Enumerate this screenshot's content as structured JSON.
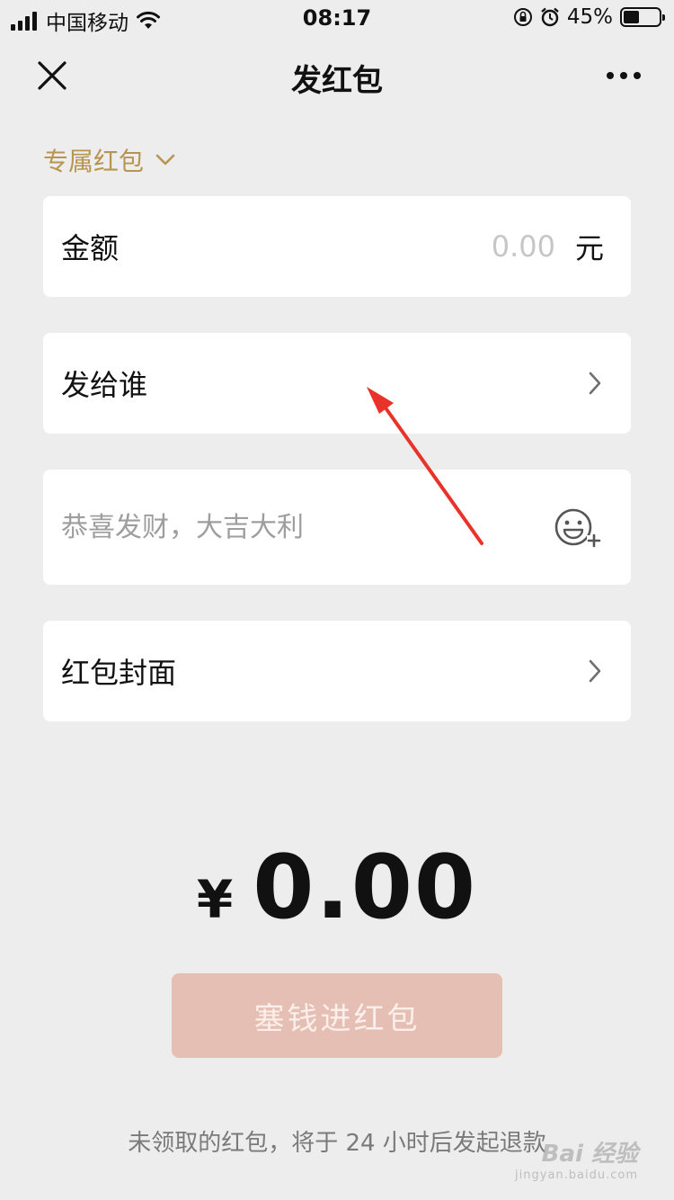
{
  "status_bar": {
    "carrier": "中国移动",
    "time": "08:17",
    "battery_percent": "45%",
    "battery_level": 0.45
  },
  "nav": {
    "title": "发红包",
    "close_icon": "close-icon",
    "more_icon": "more-dots-icon"
  },
  "packet_type": {
    "label": "专属红包",
    "icon": "chevron-down-icon",
    "color": "#b8954f"
  },
  "amount": {
    "label": "金额",
    "placeholder": "0.00",
    "unit": "元"
  },
  "recipient": {
    "label": "发给谁"
  },
  "greeting": {
    "placeholder": "恭喜发财，大吉大利",
    "emoji_icon": "emoji-add-icon"
  },
  "cover": {
    "label": "红包封面"
  },
  "total": {
    "currency": "¥",
    "value": "0.00"
  },
  "submit": {
    "label": "塞钱进红包",
    "color": "#e6bfb4"
  },
  "notice": "未领取的红包，将于 24 小时后发起退款",
  "annotation": {
    "color": "#e8322a"
  },
  "watermark": {
    "logo": "Bai 经验",
    "url": "jingyan.baidu.com"
  }
}
